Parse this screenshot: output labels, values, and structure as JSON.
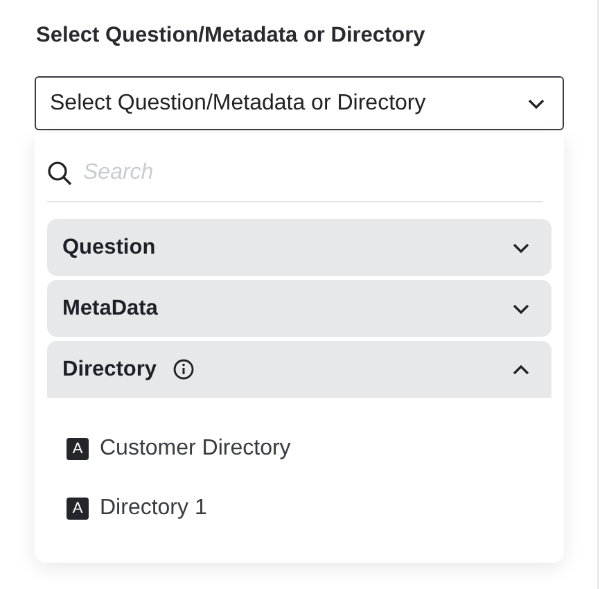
{
  "label": "Select Question/Metadata or Directory",
  "select": {
    "value": "Select Question/Metadata or Directory"
  },
  "search": {
    "placeholder": "Search"
  },
  "groups": [
    {
      "title": "Question",
      "expanded": false,
      "info": false
    },
    {
      "title": "MetaData",
      "expanded": false,
      "info": false
    },
    {
      "title": "Directory",
      "expanded": true,
      "info": true,
      "items": [
        {
          "icon_letter": "A",
          "label": "Customer Directory"
        },
        {
          "icon_letter": "A",
          "label": "Directory 1"
        }
      ]
    }
  ]
}
